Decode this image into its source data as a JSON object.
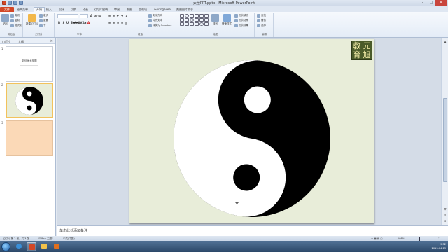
{
  "window": {
    "title": "太極PPT.pptx - Microsoft PowerPoint",
    "minimize": "–",
    "maximize": "□",
    "close": "✕"
  },
  "tabs": [
    {
      "label": "文件"
    },
    {
      "label": "经典菜单"
    },
    {
      "label": "开始"
    },
    {
      "label": "插入"
    },
    {
      "label": "设计"
    },
    {
      "label": "切换"
    },
    {
      "label": "动画"
    },
    {
      "label": "幻灯片放映"
    },
    {
      "label": "审阅"
    },
    {
      "label": "视图"
    },
    {
      "label": "加载项"
    },
    {
      "label": "iSpring Free"
    },
    {
      "label": "美图图片助手"
    }
  ],
  "ribbon": {
    "clipboard": {
      "paste": "粘贴",
      "cut": "剪切",
      "copy": "复制",
      "format": "格式刷",
      "label": "剪贴板"
    },
    "slides": {
      "new_slide": "新建幻灯片",
      "layout": "版式",
      "reset": "重置",
      "section": "节",
      "label": "幻灯片"
    },
    "font": {
      "name": "",
      "size": "",
      "label": "字体"
    },
    "paragraph": {
      "label": "段落",
      "text_direction": "文字方向",
      "align_text": "对齐文本",
      "smartart": "转换为 SmartArt"
    },
    "drawing": {
      "arrange": "排列",
      "quick_styles": "快速样式",
      "fill": "形状填充",
      "outline": "形状轮廓",
      "effects": "形状效果",
      "label": "绘图"
    },
    "editing": {
      "find": "查找",
      "replace": "替换",
      "select": "选择",
      "label": "编辑"
    }
  },
  "leftpane": {
    "tab_slides": "幻灯片",
    "tab_outline": "大纲",
    "close": "×",
    "slides": [
      {
        "num": "1",
        "text": "如何画太极图"
      },
      {
        "num": "2",
        "text": ""
      },
      {
        "num": "3",
        "text": ""
      }
    ]
  },
  "slide": {
    "logo": [
      "教",
      "元",
      "育",
      "旭"
    ]
  },
  "notes": {
    "placeholder": "单击此处添加备注"
  },
  "status": {
    "slide_info": "幻灯片 第 2 张，共 3 张",
    "theme": "\"Office 主题\"",
    "language": "中文(中国)",
    "zoom": "108%"
  },
  "taskbar": {
    "time": "9:52",
    "date": "2013-04-13"
  },
  "colors": {
    "file_tab": "#d24726",
    "slide_bg": "#e8edd9",
    "thumb_peach": "#fbd9b7",
    "logo_bg": "#4a5b2a"
  }
}
